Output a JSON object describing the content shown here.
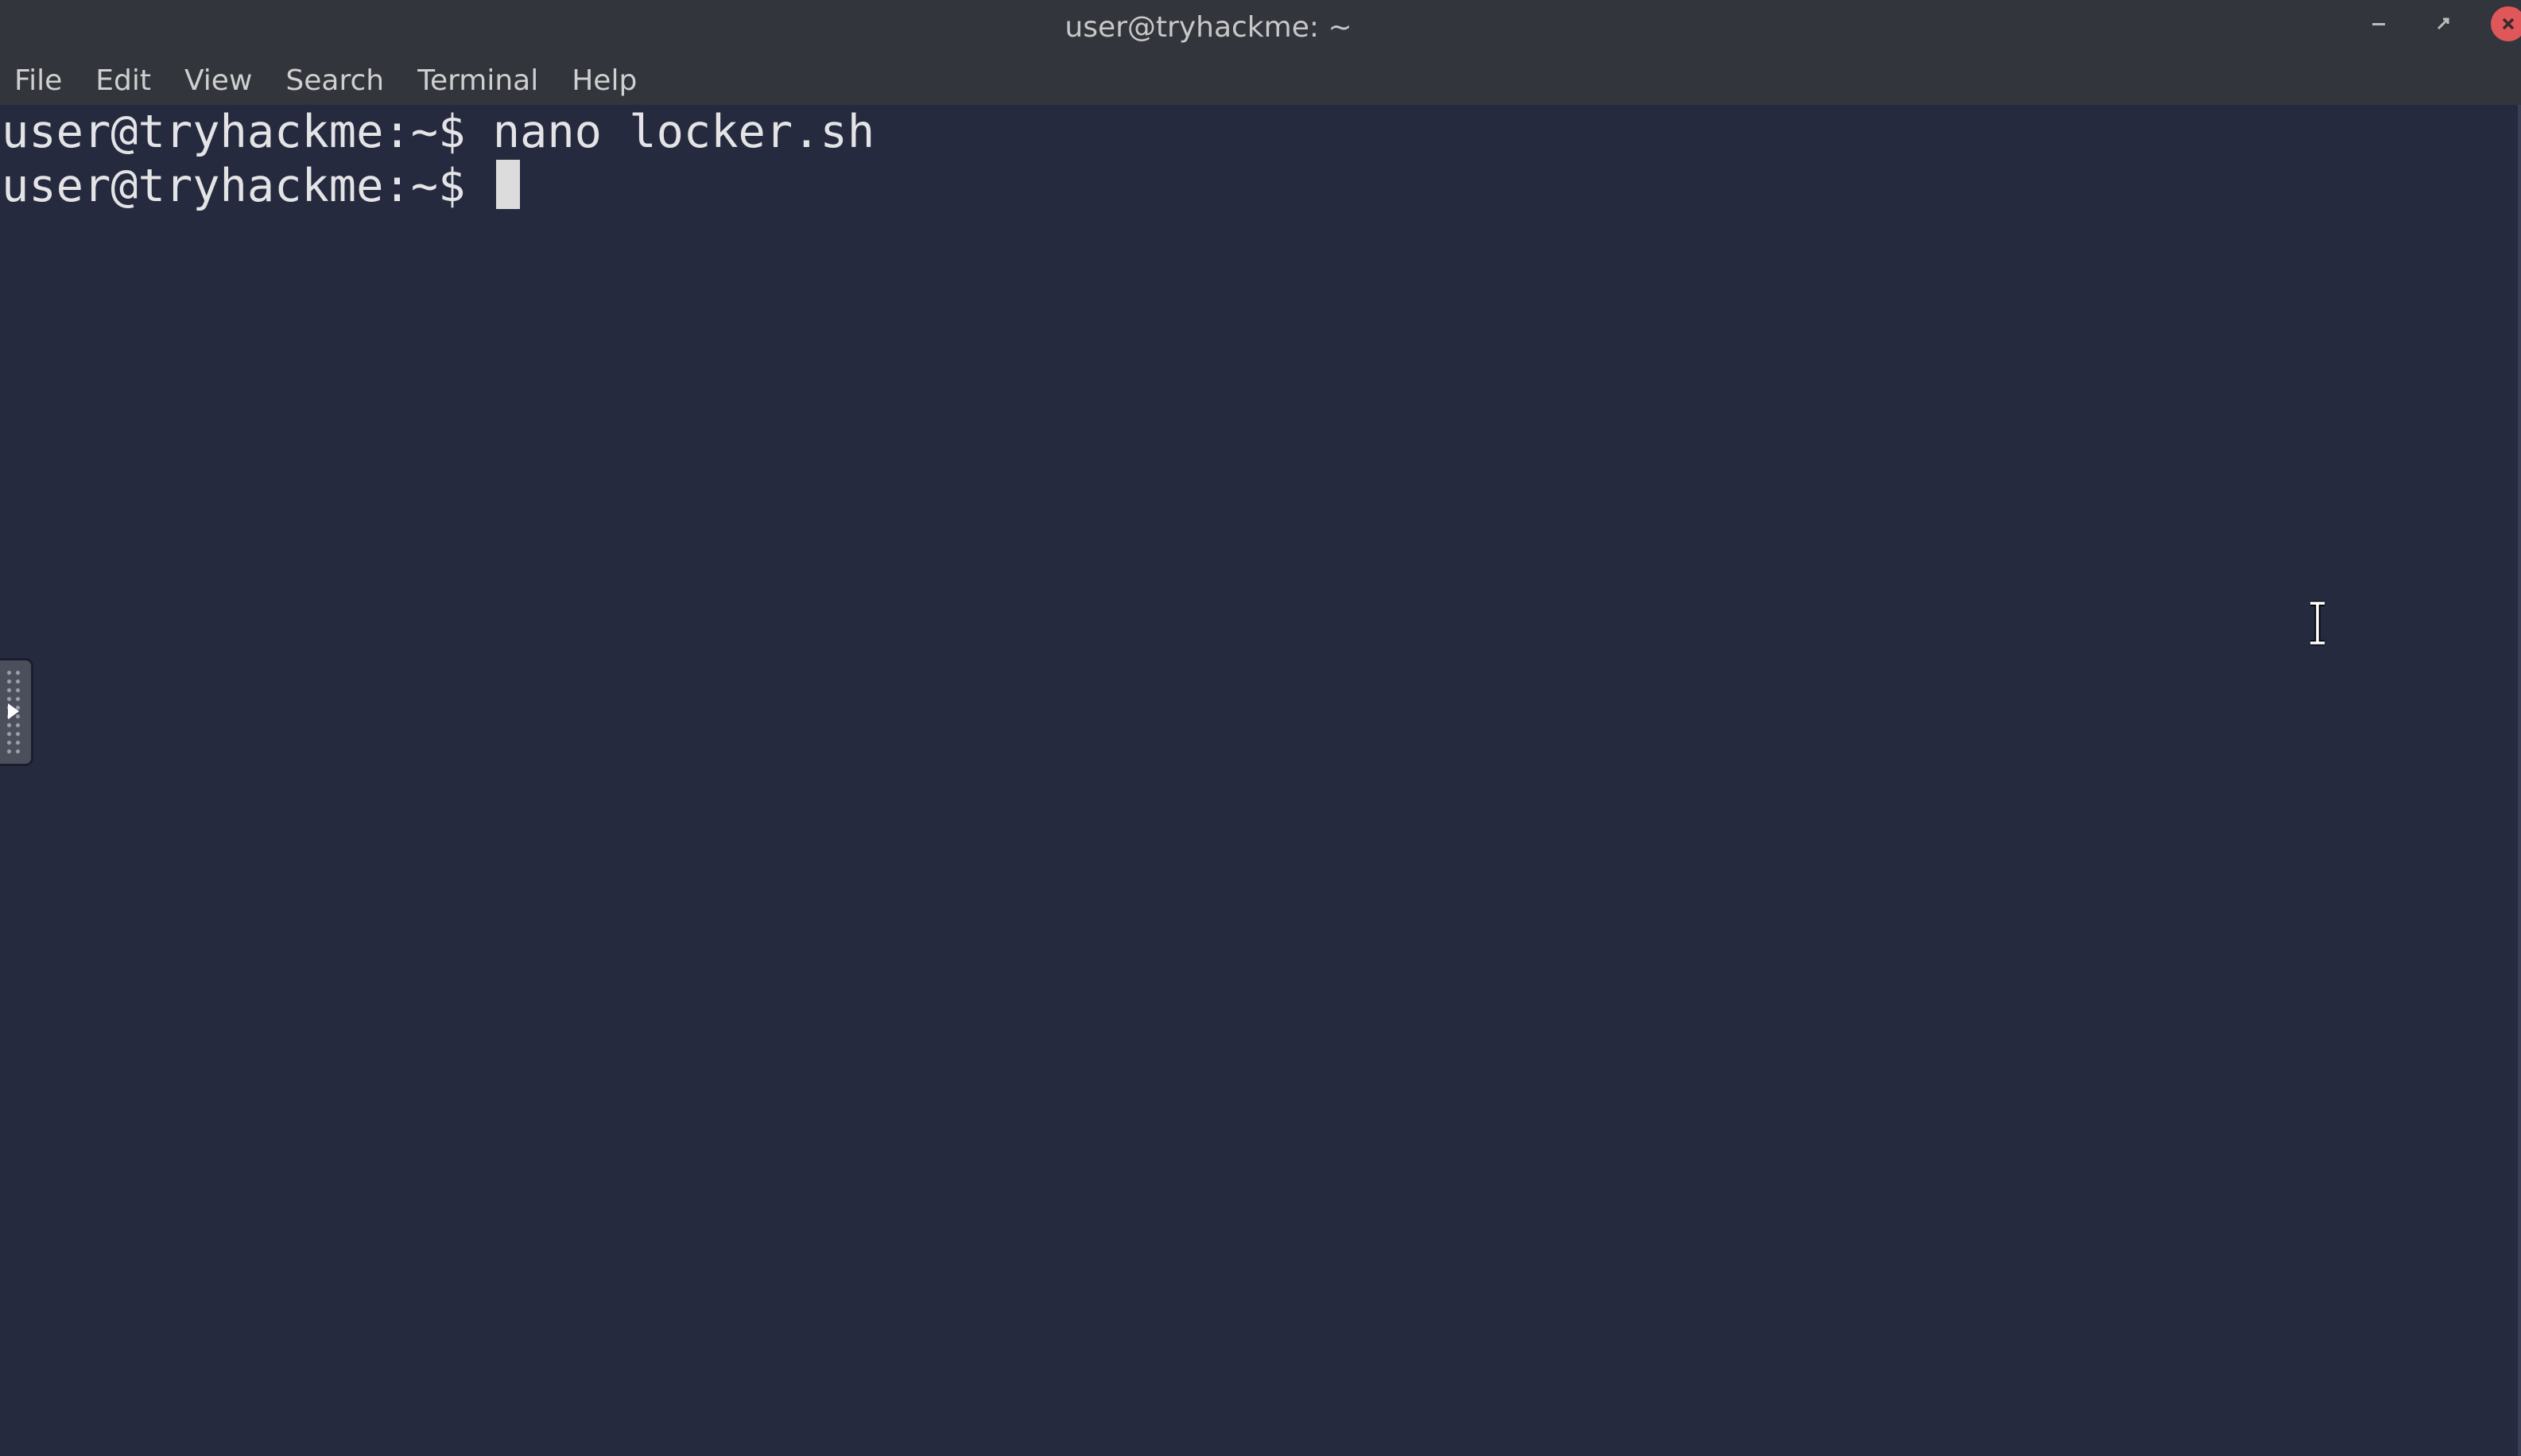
{
  "window": {
    "title": "user@tryhackme: ~"
  },
  "menu": {
    "items": [
      "File",
      "Edit",
      "View",
      "Search",
      "Terminal",
      "Help"
    ]
  },
  "terminal": {
    "lines": [
      "user@tryhackme:~$ nano locker.sh",
      "user@tryhackme:~$ "
    ]
  },
  "colors": {
    "background": "#252a3f",
    "chrome": "#33353c",
    "close_button": "#e0575a",
    "text": "#e4e4e6"
  },
  "icons": {
    "minimize": "minimize-icon",
    "maximize": "restore-icon",
    "close": "close-icon",
    "side_panel": "play-arrow-icon",
    "mouse": "ibeam-cursor-icon"
  }
}
